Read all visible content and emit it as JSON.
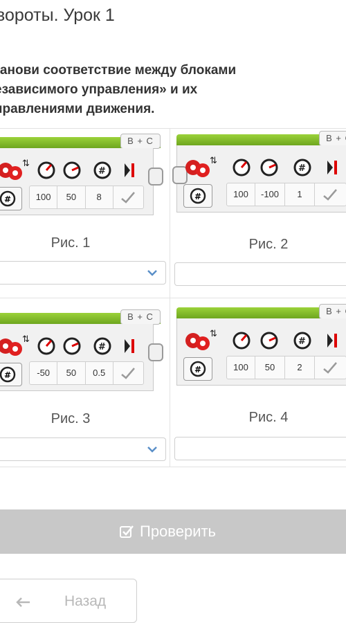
{
  "header": {
    "title": "вороты. Урок 1"
  },
  "question": {
    "lines": [
      "ганови соответствие между блоками",
      "езависимого управления» и их",
      "правлениями движения."
    ]
  },
  "figures": [
    {
      "caption": "Рис. 1",
      "ports": "B + C",
      "params": [
        "100",
        "50",
        "8"
      ],
      "selected": ""
    },
    {
      "caption": "Рис. 2",
      "ports": "B + C",
      "params": [
        "100",
        "-100",
        "1"
      ],
      "selected": ""
    },
    {
      "caption": "Рис. 3",
      "ports": "B + C",
      "params": [
        "-50",
        "50",
        "0.5"
      ],
      "selected": ""
    },
    {
      "caption": "Рис. 4",
      "ports": "B + C",
      "params": [
        "100",
        "50",
        "2"
      ],
      "selected": ""
    }
  ],
  "actions": {
    "check_label": "Проверить",
    "back_label": "Назад"
  },
  "colors": {
    "block_green": "#8cc63f",
    "motor_red": "#e02020",
    "check_button": "#c8c8c8"
  },
  "icons": [
    "motor-icon",
    "steering-icon",
    "power-gauge-icon",
    "speed-gauge-icon",
    "hash-icon",
    "end-icon",
    "checkmark-icon",
    "chevron-down-icon",
    "checkbox-icon",
    "arrow-left-icon"
  ]
}
